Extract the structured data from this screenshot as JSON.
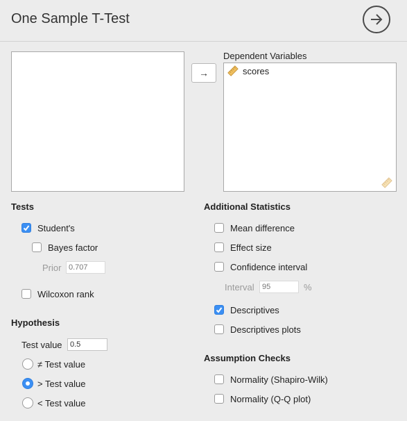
{
  "header": {
    "title": "One Sample T-Test"
  },
  "assign": {
    "arrow_label": "→"
  },
  "dependent": {
    "label": "Dependent Variables",
    "items": [
      {
        "name": "scores",
        "icon": "scale-ruler-icon"
      }
    ]
  },
  "tests": {
    "title": "Tests",
    "students": {
      "label": "Student's",
      "checked": true
    },
    "bayes": {
      "label": "Bayes factor",
      "checked": false
    },
    "prior": {
      "label": "Prior",
      "value": "0.707"
    },
    "wilcoxon": {
      "label": "Wilcoxon rank",
      "checked": false
    }
  },
  "hypothesis": {
    "title": "Hypothesis",
    "test_value_label": "Test value",
    "test_value": "0.5",
    "options": [
      {
        "label": "≠ Test value",
        "selected": false
      },
      {
        "label": "> Test value",
        "selected": true
      },
      {
        "label": "< Test value",
        "selected": false
      }
    ]
  },
  "additional": {
    "title": "Additional Statistics",
    "mean_difference": {
      "label": "Mean difference",
      "checked": false
    },
    "effect_size": {
      "label": "Effect size",
      "checked": false
    },
    "confidence_interval": {
      "label": "Confidence interval",
      "checked": false
    },
    "interval": {
      "label": "Interval",
      "value": "95",
      "unit": "%"
    },
    "descriptives": {
      "label": "Descriptives",
      "checked": true
    },
    "descriptives_plots": {
      "label": "Descriptives plots",
      "checked": false
    }
  },
  "assumptions": {
    "title": "Assumption Checks",
    "shapiro": {
      "label": "Normality (Shapiro-Wilk)",
      "checked": false
    },
    "qq": {
      "label": "Normality (Q-Q plot)",
      "checked": false
    }
  },
  "colors": {
    "accent": "#3b8ff3",
    "background": "#ececec",
    "ruler": "#f0c060"
  }
}
